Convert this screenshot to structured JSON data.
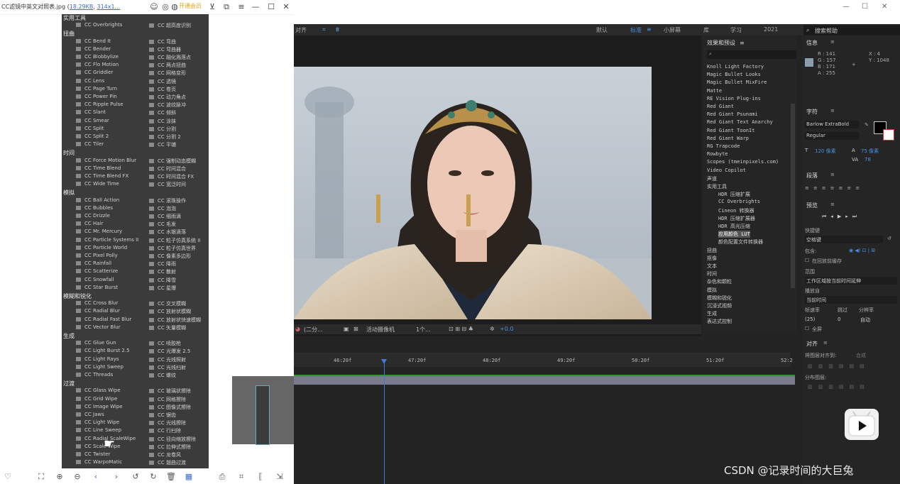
{
  "viewer": {
    "title_prefix": "CC滤镜中英文对照表.jpg (",
    "title_size": "18.29KB",
    "title_sep": ", ",
    "title_dims": "314x1...",
    "vip_label": "开通会员",
    "categories": [
      {
        "name": "实用工具",
        "items": [
          [
            "CC Overbrights",
            "CC 超高度识别"
          ]
        ]
      },
      {
        "name": "扭曲",
        "items": [
          [
            "CC Bend It",
            "CC 弯曲"
          ],
          [
            "CC Bender",
            "CC 弯曲器"
          ],
          [
            "CC Blobbylize",
            "CC 融化溅落点"
          ],
          [
            "CC Flo Motion",
            "CC 两点扭曲"
          ],
          [
            "CC Griddler",
            "CC 网格变形"
          ],
          [
            "CC Lens",
            "CC 透镜"
          ],
          [
            "CC Page Turn",
            "CC 卷页"
          ],
          [
            "CC Power Pin",
            "CC 动力角点"
          ],
          [
            "CC Ripple Pulse",
            "CC 波纹脉冲"
          ],
          [
            "CC Slant",
            "CC 倾斜"
          ],
          [
            "CC Smear",
            "CC 涂抹"
          ],
          [
            "CC Split",
            "CC 分割"
          ],
          [
            "CC Split 2",
            "CC 分割 2"
          ],
          [
            "CC Tiler",
            "CC 平铺"
          ]
        ]
      },
      {
        "name": "时间",
        "items": [
          [
            "CC Force Motion Blur",
            "CC 强制动态模糊"
          ],
          [
            "CC Time Blend",
            "CC 时间混合"
          ],
          [
            "CC Time Blend FX",
            "CC 时间混合 FX"
          ],
          [
            "CC Wide Time",
            "CC 宽泛时间"
          ]
        ]
      },
      {
        "name": "模拟",
        "items": [
          [
            "CC Ball Action",
            "CC 滚珠操作"
          ],
          [
            "CC Bubbles",
            "CC 泡泡"
          ],
          [
            "CC Drizzle",
            "CC 细雨滴"
          ],
          [
            "CC Hair",
            "CC 毛发"
          ],
          [
            "CC Mr. Mercury",
            "CC 水银滴落"
          ],
          [
            "CC Particle Systems II",
            "CC 粒子仿真系统 II"
          ],
          [
            "CC Particle World",
            "CC 粒子仿真世界"
          ],
          [
            "CC Pixel Polly",
            "CC 像素多边形"
          ],
          [
            "CC Rainfall",
            "CC 降雨"
          ],
          [
            "CC Scatterize",
            "CC 散射"
          ],
          [
            "CC Snowfall",
            "CC 降雪"
          ],
          [
            "CC Star Burst",
            "CC 星爆"
          ]
        ]
      },
      {
        "name": "模糊和锐化",
        "items": [
          [
            "CC Cross Blur",
            "CC 交叉模糊"
          ],
          [
            "CC Radial Blur",
            "CC 放射状模糊"
          ],
          [
            "CC Radial Fast Blur",
            "CC 放射状快速模糊"
          ],
          [
            "CC Vector Blur",
            "CC 矢量模糊"
          ]
        ]
      },
      {
        "name": "生成",
        "items": [
          [
            "CC Glue Gun",
            "CC 喷胶枪"
          ],
          [
            "CC Light Burst 2.5",
            "CC 光爆发 2.5"
          ],
          [
            "CC Light Rays",
            "CC 光线照射"
          ],
          [
            "CC Light Sweep",
            "CC 光线扫射"
          ],
          [
            "CC Threads",
            "CC 螺纹"
          ]
        ]
      },
      {
        "name": "过渡",
        "items": [
          [
            "CC Glass Wipe",
            "CC 玻璃状擦除"
          ],
          [
            "CC Grid Wipe",
            "CC 网格擦除"
          ],
          [
            "CC Image Wipe",
            "CC 图像式擦除"
          ],
          [
            "CC Jaws",
            "CC 锯齿"
          ],
          [
            "CC Light Wipe",
            "CC 光线擦除"
          ],
          [
            "CC Line Sweep",
            "CC 行扫除"
          ],
          [
            "CC Radial ScaleWipe",
            "CC 径向缩放擦除"
          ],
          [
            "CC Scale Wipe",
            "CC 拉伸式擦除"
          ],
          [
            "CC Twister",
            "CC 龙卷风"
          ],
          [
            "CC WarpoMatic",
            "CC 翘曲过渡"
          ]
        ]
      }
    ]
  },
  "ae": {
    "menu": [
      "对齐",
      "默认",
      "标准",
      "小屏幕",
      "库",
      "学习",
      "2021"
    ],
    "search_help": "搜索帮助",
    "effects_title": "效果和预设",
    "effects_list": [
      "Knoll Light Factory",
      "Magic Bullet Looks",
      "Magic Bullet MixFire",
      "Matte",
      "RE Vision Plug-ins",
      "Red Giant",
      "Red Giant Psunami",
      "Red Giant Text Anarchy",
      "Red Giant ToonIt",
      "Red Giant Warp",
      "RG Trapcode",
      "Rowbyte",
      "Scopes (tmeinpixels.com)",
      "Video Copilot",
      "声道",
      "实用工具"
    ],
    "effects_sub": [
      "HDR 压缩扩展",
      "CC Overbrights",
      "Cineon 转换器",
      "HDR 压缩扩展器",
      "HDR 高光压缩",
      "应用颜色 LUT",
      "颜色配置文件转换器"
    ],
    "effects_sub_selected": 5,
    "effects_after": [
      "扭曲",
      "抠像",
      "文本",
      "时间",
      "杂色和颗粒",
      "模拟",
      "模糊和锐化",
      "沉浸式视频",
      "生成",
      "表达式控制"
    ],
    "info": {
      "title": "信息",
      "r": "R : 141",
      "g": "G : 157",
      "b": "B : 171",
      "a": "A : 255",
      "x": "X : 4",
      "y": "Y : 1048"
    },
    "char": {
      "title": "字符",
      "font": "Barlow ExtraBold",
      "style": "Regular",
      "size": "120 像素",
      "leading": "75 像素",
      "tracking": "78"
    },
    "para_title": "段落",
    "preview": {
      "title": "预览",
      "shortcut_label": "快捷键",
      "shortcut": "空格键",
      "include": "包含:",
      "cache": "在回放前缓存",
      "range_label": "范围",
      "range": "工作区域按当前时间延伸",
      "play_label": "播放自",
      "play": "当前时间",
      "fps_label": "帧速率",
      "skip_label": "跳过",
      "res_label": "分辨率",
      "fps": "(25)",
      "skip": "0",
      "res": "自动",
      "fullscreen": "全屏"
    },
    "align": {
      "title": "对齐",
      "to": "将图层对齐到:",
      "to_val": "合成",
      "dist": "分布图层:"
    },
    "comp_bar": {
      "zoom": "(二分...",
      "camera": "活动摄像机",
      "view": "1个...",
      "exposure": "+0.0"
    },
    "timeline_ticks": [
      "46:20f",
      "47:20f",
      "48:20f",
      "49:20f",
      "50:20f",
      "51:20f",
      "52:2"
    ]
  },
  "watermark": "CSDN @记录时间的大巨兔"
}
